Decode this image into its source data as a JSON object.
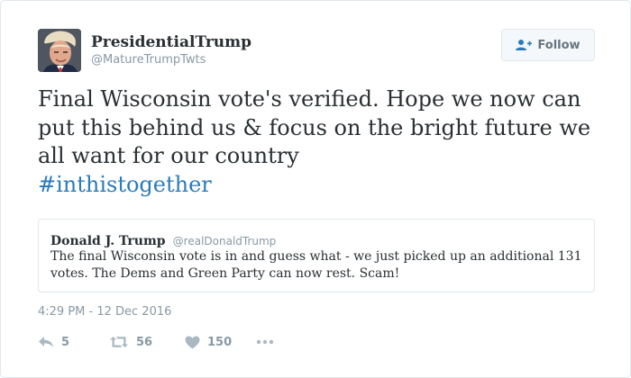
{
  "user": {
    "display_name": "PresidentialTrump",
    "screen_name": "@MatureTrumpTwts"
  },
  "follow_button": {
    "label": "Follow",
    "icon": "add-user-icon"
  },
  "tweet": {
    "text": "Final Wisconsin vote's verified. Hope we now can put this behind us & focus on the bright future we all want for our country",
    "hashtag": "#inthistogether",
    "timestamp": "4:29 PM - 12 Dec 2016"
  },
  "quoted_tweet": {
    "name": "Donald J. Trump",
    "handle": "@realDonaldTrump",
    "text": "The final Wisconsin vote is in and guess what - we just picked up an additional 131 votes. The Dems and Green Party can now rest. Scam!"
  },
  "actions": {
    "replies": "5",
    "retweets": "56",
    "likes": "150"
  },
  "colors": {
    "text": "#292f33",
    "muted": "#8899a6",
    "link": "#2b7bb9",
    "border": "#e1e8ed"
  }
}
